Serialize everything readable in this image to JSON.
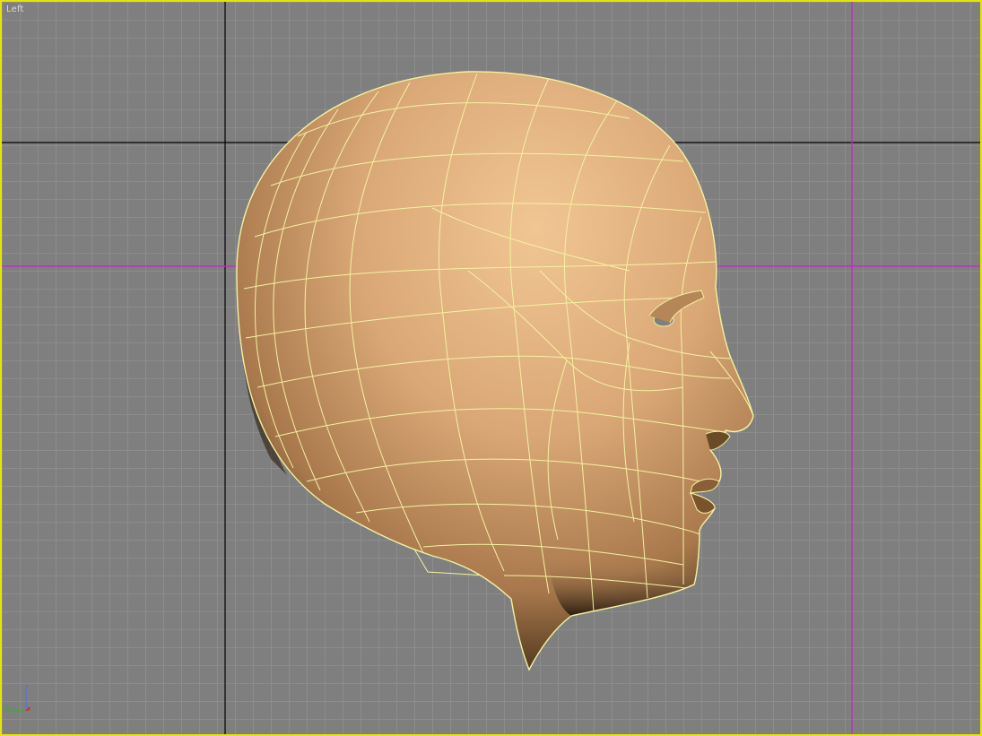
{
  "viewport": {
    "label": "Left",
    "view": "left",
    "border_color": "#e6e600",
    "background_color": "#7f7f7f",
    "grid_minor_color": "#999999",
    "grid_major_color": "#000000",
    "helper_axis_color": "#cc22cc"
  },
  "model": {
    "name": "head",
    "surface_color": "#d9a775",
    "wire_color": "#f4f1a0"
  },
  "axis_tripod": {
    "z_label": "z",
    "y_label": "y",
    "x_label": "x",
    "z_color": "#4a6cff",
    "y_color": "#22bb22",
    "x_color": "#dd2222"
  }
}
